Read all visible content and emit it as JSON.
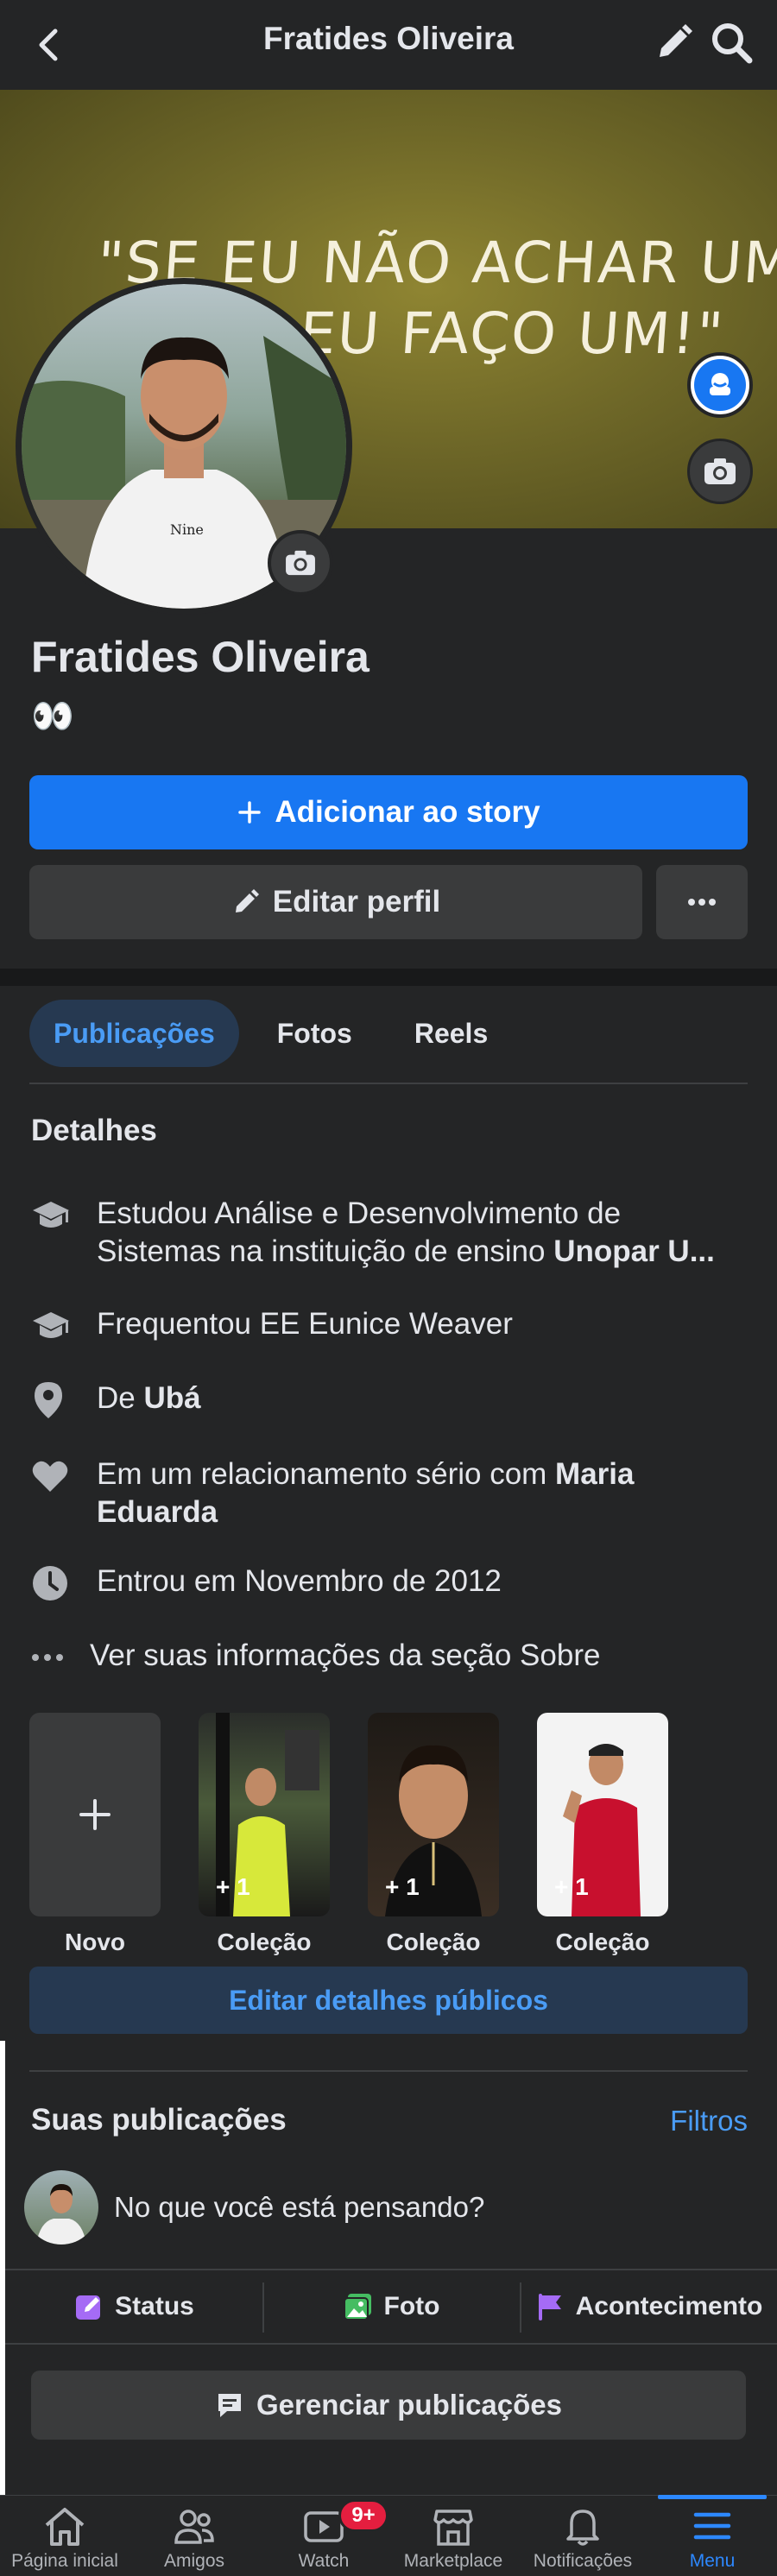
{
  "header": {
    "title": "Fratides Oliveira",
    "back_icon": "chevron-left-icon",
    "edit_icon": "pencil-icon",
    "search_icon": "search-icon"
  },
  "cover": {
    "quote_line1": "\"SE EU NÃO ACHAR UM",
    "quote_line2": "EU FAÇO UM!\""
  },
  "profile": {
    "name": "Fratides Oliveira",
    "bio": "👀"
  },
  "buttons": {
    "add_story": "Adicionar ao story",
    "edit_profile": "Editar perfil"
  },
  "tabs": [
    {
      "label": "Publicações",
      "active": true
    },
    {
      "label": "Fotos",
      "active": false
    },
    {
      "label": "Reels",
      "active": false
    }
  ],
  "details": {
    "title": "Detalhes",
    "study_prefix": "Estudou Análise e Desenvolvimento de",
    "study_middle": "Sistemas na instituição de ensino ",
    "study_bold": "Unopar U...",
    "school": "Frequentou EE Eunice Weaver",
    "from_prefix": "De ",
    "from_bold": "Ubá",
    "rel_prefix": "Em um relacionamento sério com ",
    "rel_bold1": "Maria",
    "rel_bold2": "Eduarda",
    "joined": "Entrou em Novembro de 2012",
    "see_about": "Ver suas informações da seção Sobre"
  },
  "featured": [
    {
      "label": "Novo",
      "count": ""
    },
    {
      "label": "Coleção",
      "count": "+ 1"
    },
    {
      "label": "Coleção",
      "count": "+ 1"
    },
    {
      "label": "Coleção",
      "count": "+ 1"
    }
  ],
  "edit_public": "Editar detalhes públicos",
  "posts": {
    "title": "Suas publicações",
    "filters": "Filtros",
    "composer_placeholder": "No que você está pensando?",
    "actions": [
      "Status",
      "Foto",
      "Acontecimento"
    ],
    "manage": "Gerenciar publicações"
  },
  "bottom_nav": [
    {
      "label": "Página inicial",
      "icon": "home-icon",
      "active": false
    },
    {
      "label": "Amigos",
      "icon": "friends-icon",
      "active": false
    },
    {
      "label": "Watch",
      "icon": "watch-icon",
      "active": false,
      "badge": "9+"
    },
    {
      "label": "Marketplace",
      "icon": "marketplace-icon",
      "active": false
    },
    {
      "label": "Notificações",
      "icon": "bell-icon",
      "active": false
    },
    {
      "label": "Menu",
      "icon": "menu-icon",
      "active": true
    }
  ],
  "colors": {
    "background": "#242526",
    "accent": "#1877f2",
    "link": "#4a9cf5",
    "badge": "#e41e3f"
  }
}
